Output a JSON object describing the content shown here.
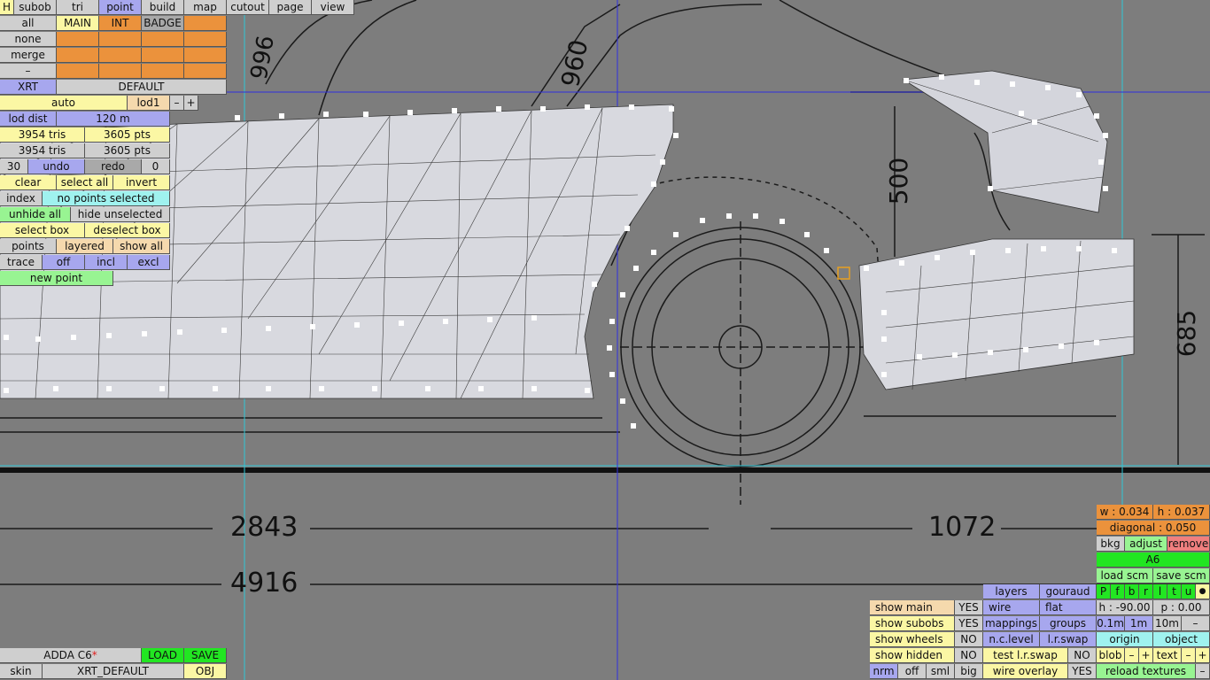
{
  "menu": {
    "h": "H",
    "tabs": [
      "subob",
      "tri",
      "point",
      "build",
      "map",
      "cutout",
      "page",
      "view"
    ]
  },
  "sel": {
    "all": "all",
    "none": "none",
    "merge": "merge",
    "dash": "–",
    "main": "MAIN",
    "int": "INT",
    "badge": "BADGE"
  },
  "xrt": "XRT",
  "default": "DEFAULT",
  "lod": {
    "auto": "auto",
    "lod1": "lod1",
    "minus": "–",
    "plus": "+",
    "dist_label": "lod dist",
    "dist_value": "120 m"
  },
  "counts": {
    "tris_a": "3954 tris",
    "pts_a": "3605 pts",
    "tris_b": "3954 tris",
    "pts_b": "3605 pts"
  },
  "undo": {
    "n": "30",
    "undo": "undo",
    "redo": "redo",
    "zero": "0"
  },
  "tools": {
    "clear": "clear",
    "select_all": "select all",
    "invert": "invert",
    "index": "index",
    "no_points": "no points selected",
    "unhide_all": "unhide all",
    "hide_unselected": "hide unselected",
    "select_box": "select box",
    "deselect_box": "deselect box",
    "points": "points",
    "layered": "layered",
    "show_all": "show all",
    "trace": "trace",
    "off": "off",
    "incl": "incl",
    "excl": "excl",
    "new_point": "new point"
  },
  "file": {
    "name": "ADDA C6",
    "star": "*",
    "load": "LOAD",
    "save": "SAVE",
    "skin": "skin",
    "skin_value": "XRT_DEFAULT",
    "obj": "OBJ"
  },
  "right": {
    "w": "w : 0.034",
    "h": "h : 0.037",
    "diagonal": "diagonal : 0.050",
    "bkg": "bkg",
    "adjust": "adjust",
    "remove": "remove",
    "a6": "A6",
    "load_scm": "load scm",
    "save_scm": "save scm",
    "letters": [
      "P",
      "f",
      "b",
      "r",
      "l",
      "t",
      "u"
    ],
    "dot": "●",
    "h_val": "h : -90.00",
    "p_val": "p : 0.00",
    "s01": "0.1m",
    "s1": "1m",
    "s10": "10m",
    "dash": "–",
    "origin": "origin",
    "object": "object",
    "blob": "blob",
    "text": "text",
    "reload": "reload textures"
  },
  "bottom": {
    "show_main": "show main",
    "yes1": "YES",
    "show_subobs": "show subobs",
    "yes2": "YES",
    "show_wheels": "show wheels",
    "no1": "NO",
    "show_hidden": "show hidden",
    "no2": "NO",
    "nrm": "nrm",
    "off": "off",
    "sml": "sml",
    "big": "big",
    "layers": "layers",
    "gouraud": "gouraud",
    "wire": "wire",
    "flat": "flat",
    "mappings": "mappings",
    "groups": "groups",
    "nclevel": "n.c.level",
    "lrswap": "l.r.swap",
    "test_lrswap": "test l.r.swap",
    "no3": "NO",
    "wire_overlay": "wire overlay",
    "yes3": "YES"
  },
  "dims": {
    "d996": "996",
    "d960": "960",
    "d500": "500",
    "d685": "685",
    "d2843": "2843",
    "d1072": "1072",
    "d4916": "4916"
  }
}
